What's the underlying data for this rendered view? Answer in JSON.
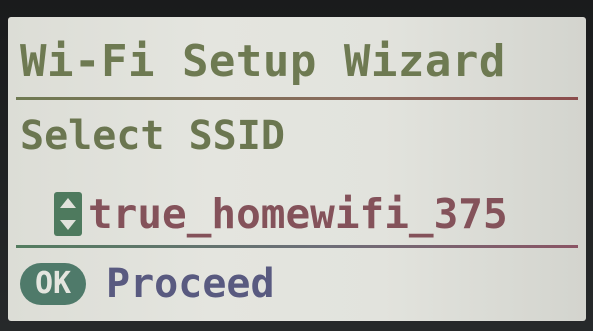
{
  "screen": {
    "title": "Wi-Fi Setup Wizard",
    "subtitle": "Select SSID",
    "ssid_selector": {
      "icon": "up-down-arrows-icon",
      "value": "true_homewifi_375"
    },
    "action": {
      "button_label": "OK",
      "label": "Proceed"
    }
  },
  "colors": {
    "screen_background": "#e2e3dd",
    "title_text": "#6e7a52",
    "ssid_text": "#84525a",
    "proceed_text": "#595a80",
    "accent_green": "#4f7a6a"
  }
}
